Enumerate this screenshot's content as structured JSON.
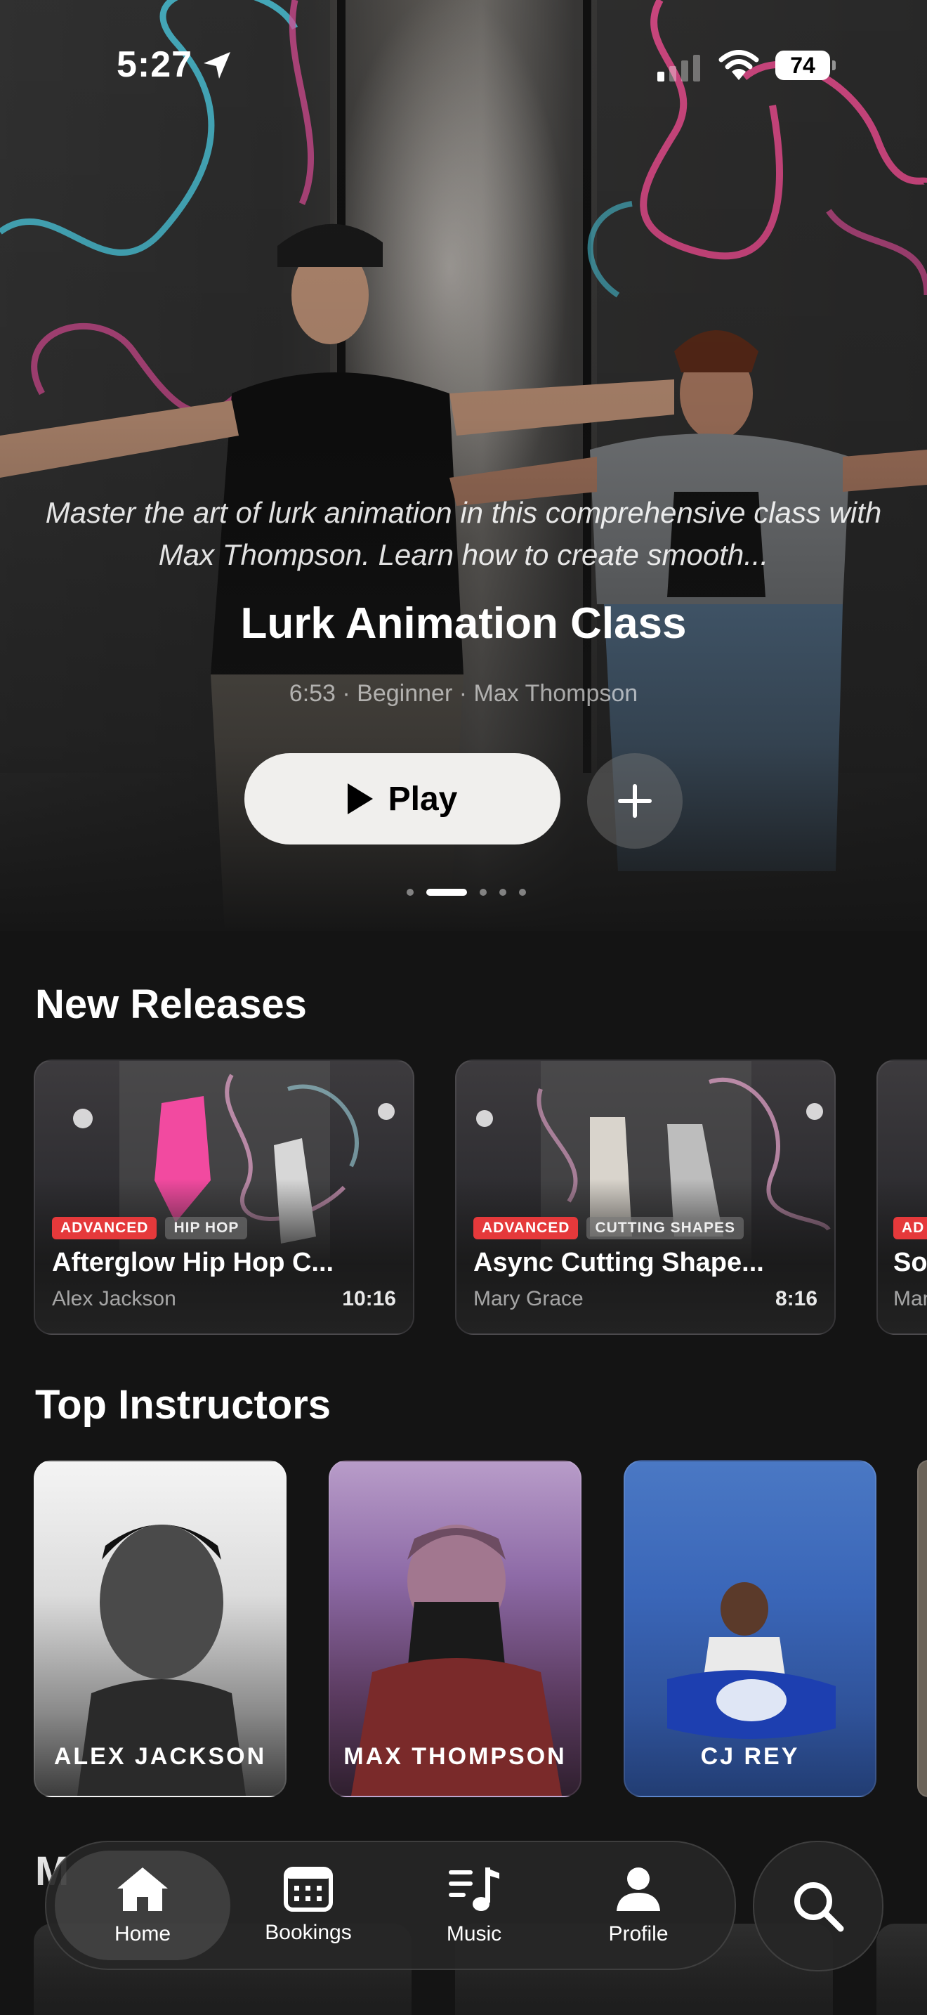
{
  "status_bar": {
    "time": "5:27",
    "battery": "74"
  },
  "hero": {
    "description": "Master the art of lurk animation in this comprehensive class with Max Thompson. Learn how to create smooth...",
    "title": "Lurk Animation Class",
    "meta": "6:53 · Beginner · Max Thompson",
    "play_label": "Play",
    "page_indicator": {
      "count": 5,
      "active_index": 1
    }
  },
  "new_releases": {
    "title": "New Releases",
    "items": [
      {
        "level": "ADVANCED",
        "genre": "HIP HOP",
        "title": "Afterglow Hip Hop C...",
        "instructor": "Alex Jackson",
        "duration": "10:16"
      },
      {
        "level": "ADVANCED",
        "genre": "CUTTING SHAPES",
        "title": "Async Cutting Shape...",
        "instructor": "Mary Grace",
        "duration": "8:16"
      },
      {
        "level": "AD",
        "title": "So",
        "instructor": "Mar"
      }
    ]
  },
  "top_instructors": {
    "title": "Top Instructors",
    "items": [
      {
        "name": "ALEX JACKSON"
      },
      {
        "name": "MAX THOMPSON"
      },
      {
        "name": "CJ REY"
      }
    ]
  },
  "next_section_peek": "M",
  "tab_bar": {
    "tabs": [
      {
        "label": "Home",
        "icon": "house-icon",
        "active": true
      },
      {
        "label": "Bookings",
        "icon": "calendar-icon",
        "active": false
      },
      {
        "label": "Music",
        "icon": "music-note-icon",
        "active": false
      },
      {
        "label": "Profile",
        "icon": "person-icon",
        "active": false
      }
    ],
    "search_icon": "magnifying-glass-icon"
  },
  "colors": {
    "advanced_tag": "#e5393b",
    "background": "#141414",
    "play_button": "#f0efed"
  }
}
